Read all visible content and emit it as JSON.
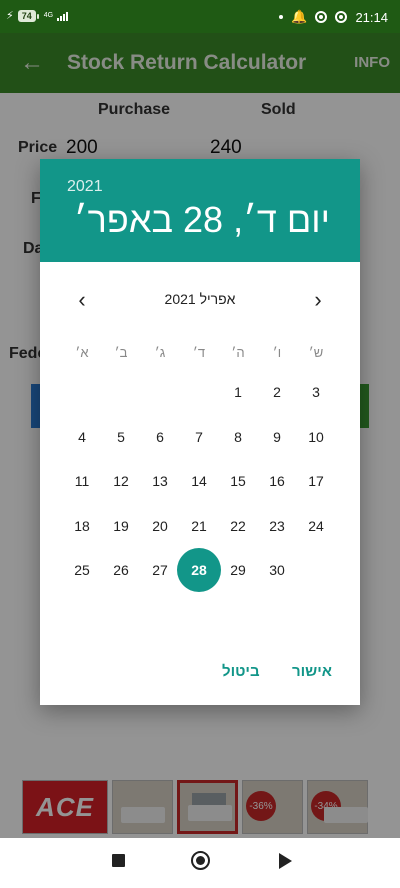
{
  "status_bar": {
    "battery": "74",
    "network": "4G",
    "time": "21:14",
    "icons": [
      "bolt-icon",
      "signal-icon",
      "dot-icon",
      "alarm-icon",
      "data-saver-icon",
      "sync-icon",
      "wifi-icon",
      "battery-icon"
    ]
  },
  "app_bar": {
    "title": "Stock Return Calculator",
    "info_label": "INFO",
    "back_icon": "arrow-left-icon"
  },
  "form": {
    "purchase_header": "Purchase",
    "sold_header": "Sold",
    "price_label": "Price",
    "purchase_price": "200",
    "sold_price": "240",
    "fee_label_fragment": "F",
    "date_label_fragment": "Da",
    "federal_label_fragment": "Fede"
  },
  "ads": {
    "brand": "ACE",
    "discounts": [
      "-36%",
      "-34%"
    ]
  },
  "date_picker": {
    "year": "2021",
    "selected_display": "יום ד׳, 28 באפר׳",
    "month_label": "אפריל 2021",
    "weekdays": [
      "ש׳",
      "ו׳",
      "ה׳",
      "ד׳",
      "ג׳",
      "ב׳",
      "א׳"
    ],
    "days": [
      "1",
      "2",
      "3",
      "4",
      "5",
      "6",
      "7",
      "8",
      "9",
      "10",
      "11",
      "12",
      "13",
      "14",
      "15",
      "16",
      "17",
      "18",
      "19",
      "20",
      "21",
      "22",
      "23",
      "24",
      "25",
      "26",
      "27",
      "28",
      "29",
      "30"
    ],
    "selected_day": "28",
    "ok_label": "אישור",
    "cancel_label": "ביטול"
  },
  "colors": {
    "status_bar": "#1f5a14",
    "app_bar": "#3c8b28",
    "dialog_accent": "#129689"
  }
}
